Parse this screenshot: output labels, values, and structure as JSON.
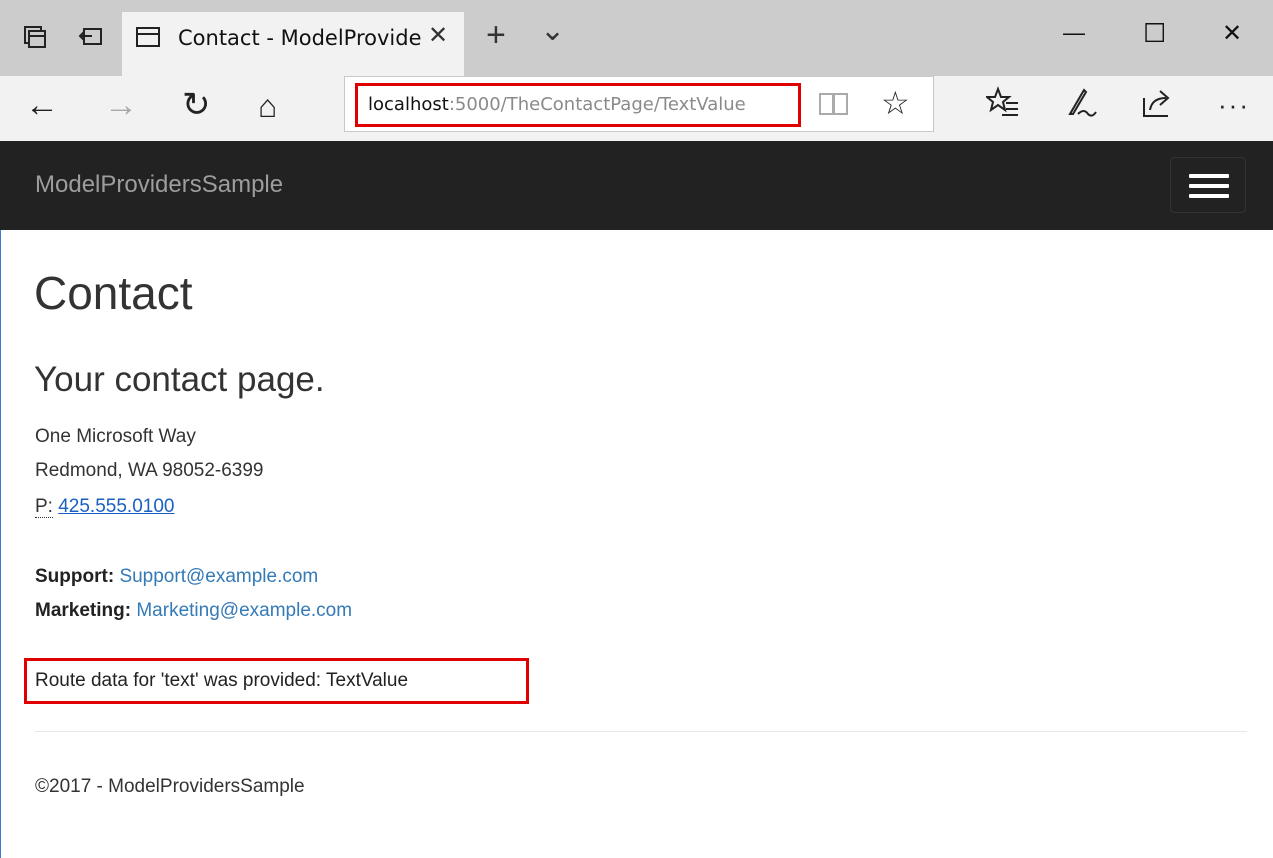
{
  "browser": {
    "tab": {
      "title": "Contact - ModelProvide",
      "close_glyph": "✕"
    },
    "new_tab_glyph": "+",
    "tab_list_glyph": "⌄",
    "window": {
      "minimize": "—",
      "maximize": "☐",
      "close": "✕"
    },
    "address": {
      "host": "localhost",
      "path": ":5000/TheContactPage/TextValue"
    },
    "nav": {
      "back": "←",
      "forward": "→",
      "refresh": "↻",
      "home": "⌂"
    },
    "toolbar": {
      "favorites": "☆",
      "more": "···"
    },
    "highlight_color": "#e00000"
  },
  "site": {
    "brand": "ModelProvidersSample",
    "header_bg": "#222222"
  },
  "page": {
    "title": "Contact",
    "subtitle": "Your contact page.",
    "address_line1": "One Microsoft Way",
    "address_line2": "Redmond, WA 98052-6399",
    "phone_label": "P:",
    "phone": "425.555.0100",
    "support_label": "Support:",
    "support_email": "Support@example.com",
    "marketing_label": "Marketing:",
    "marketing_email": "Marketing@example.com",
    "route_message": "Route data for 'text' was provided: TextValue",
    "footer": "©2017 - ModelProvidersSample",
    "link_color": "#337ab7"
  }
}
